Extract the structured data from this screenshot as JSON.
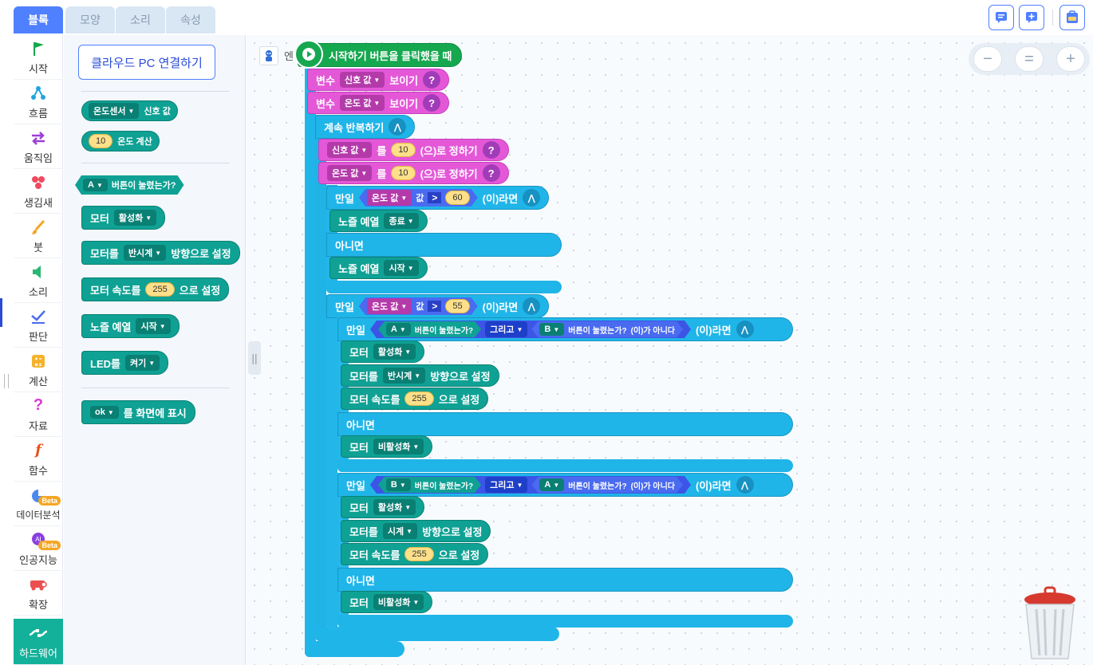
{
  "tabs": [
    "블록",
    "모양",
    "소리",
    "속성"
  ],
  "categories": [
    {
      "label": "시작",
      "icon": "flag-icon"
    },
    {
      "label": "흐름",
      "icon": "flow-icon"
    },
    {
      "label": "움직임",
      "icon": "arrows-icon"
    },
    {
      "label": "생김새",
      "icon": "shapes-icon"
    },
    {
      "label": "붓",
      "icon": "brush-icon"
    },
    {
      "label": "소리",
      "icon": "speaker-icon"
    },
    {
      "label": "판단",
      "icon": "check-icon"
    },
    {
      "label": "계산",
      "icon": "calculator-icon"
    },
    {
      "label": "자료",
      "icon": "question-icon"
    },
    {
      "label": "함수",
      "icon": "function-icon"
    },
    {
      "label": "데이터분석",
      "icon": "pie-icon",
      "badge": "Beta"
    },
    {
      "label": "인공지능",
      "icon": "ai-icon",
      "badge": "Beta"
    },
    {
      "label": "확장",
      "icon": "extension-icon"
    },
    {
      "label": "하드웨어",
      "icon": "hardware-icon"
    }
  ],
  "palette": {
    "cloud_button": "클라우드 PC 연결하기",
    "temp_sensor": "온도센서",
    "signal_value": "신호 값",
    "num10": "10",
    "temp_calc": "온도 계산",
    "btn_a": "A",
    "pressed": "버튼이 눌렸는가?",
    "motor": "모터",
    "activate": "활성화",
    "motor_dir": "모터를",
    "ccw": "반시계",
    "dir_set": "방향으로 설정",
    "motor_speed": "모터 속도를",
    "num255": "255",
    "set_to": "으로 설정",
    "buzzer": "노즐 예열",
    "start": "시작",
    "led": "LED를",
    "on": "켜기",
    "ok": "ok",
    "show_screen": "를 화면에 표시"
  },
  "script": {
    "entity_label": "엔",
    "hat": "시작하기 버튼을 클릭했을 때",
    "var": "변수",
    "show": "보이기",
    "signal": "신호 값",
    "temp": "온도 값",
    "repeat": "계속 반복하기",
    "to": "를",
    "set_to": "(으)로 정하기",
    "if": "만일",
    "then": "(이)라면",
    "value": "값",
    "gt": ">",
    "n10": "10",
    "n60": "60",
    "n55": "55",
    "nozzle": "노즐 예열",
    "end": "종료",
    "start": "시작",
    "else": "아니면",
    "a": "A",
    "b": "B",
    "pressed": "버튼이 눌렸는가?",
    "and": "그리고",
    "not": "(이)가 아니다",
    "motor": "모터",
    "activate": "활성화",
    "deactivate": "비활성화",
    "motor_dir": "모터를",
    "ccw": "반시계",
    "cw": "시계",
    "dir_set": "방향으로 설정",
    "motor_speed": "모터 속도를",
    "n255": "255",
    "speed_set": "으로 설정"
  },
  "zoom": {
    "minus": "−",
    "reset": "=",
    "plus": "+"
  },
  "colors": {
    "accent": "#4f80ff",
    "hardware": "#0fa194",
    "variable": "#e458d8",
    "flow": "#20b5e8",
    "start": "#16a84f"
  }
}
